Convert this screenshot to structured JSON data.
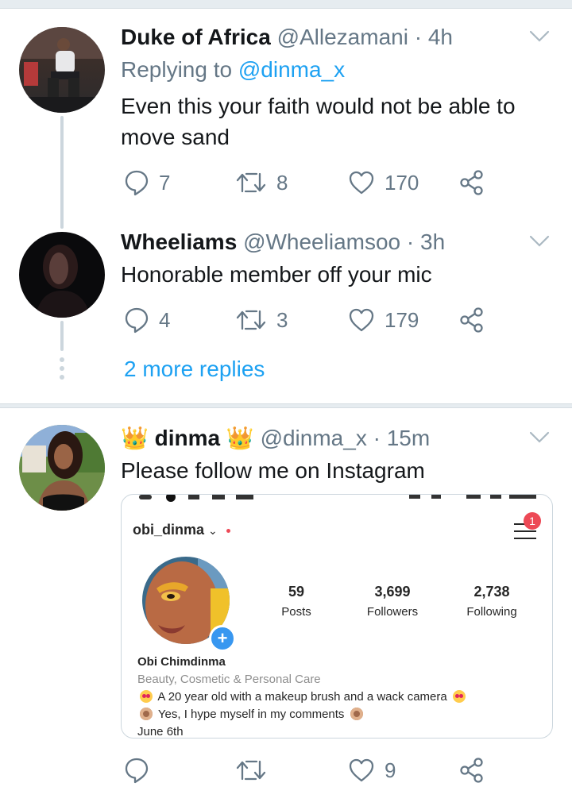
{
  "tweets": [
    {
      "name": "Duke of Africa",
      "handle": "@Allezamani",
      "time": "4h",
      "replying_prefix": "Replying to",
      "replying_to": "@dinma_x",
      "text": "Even this your faith would not be able to move sand",
      "replies": "7",
      "retweets": "8",
      "likes": "170"
    },
    {
      "name": "Wheeliams",
      "handle": "@Wheeliamsoo",
      "time": "3h",
      "text": "Honorable member off your mic",
      "replies": "4",
      "retweets": "3",
      "likes": "179"
    },
    {
      "name": "dinma",
      "handle": "@dinma_x",
      "time": "15m",
      "text": "Please follow me on Instagram",
      "replies": "",
      "retweets": "",
      "likes": "9"
    }
  ],
  "more_replies": "2 more replies",
  "separator": "·",
  "instagram": {
    "username": "obi_dinma",
    "badge": "1",
    "posts_count": "59",
    "posts_label": "Posts",
    "followers_count": "3,699",
    "followers_label": "Followers",
    "following_count": "2,738",
    "following_label": "Following",
    "full_name": "Obi Chimdinma",
    "category": "Beauty, Cosmetic & Personal Care",
    "bio_line1": "A 20 year old with a makeup brush and a wack camera",
    "bio_line2": "Yes, I hype myself in my comments",
    "bio_line3": "June 6th"
  },
  "icons": {
    "reply": "speech-bubble-icon",
    "retweet": "retweet-arrows-icon",
    "like": "heart-icon",
    "share": "share-nodes-icon",
    "menu": "chevron-down-icon",
    "crown": "crown-emoji-icon"
  },
  "colors": {
    "link": "#1da1f2",
    "muted": "#657786",
    "text": "#14171a",
    "thread_line": "#ccd6dd",
    "ig_blue": "#3897f0",
    "ig_red": "#ed4956"
  }
}
